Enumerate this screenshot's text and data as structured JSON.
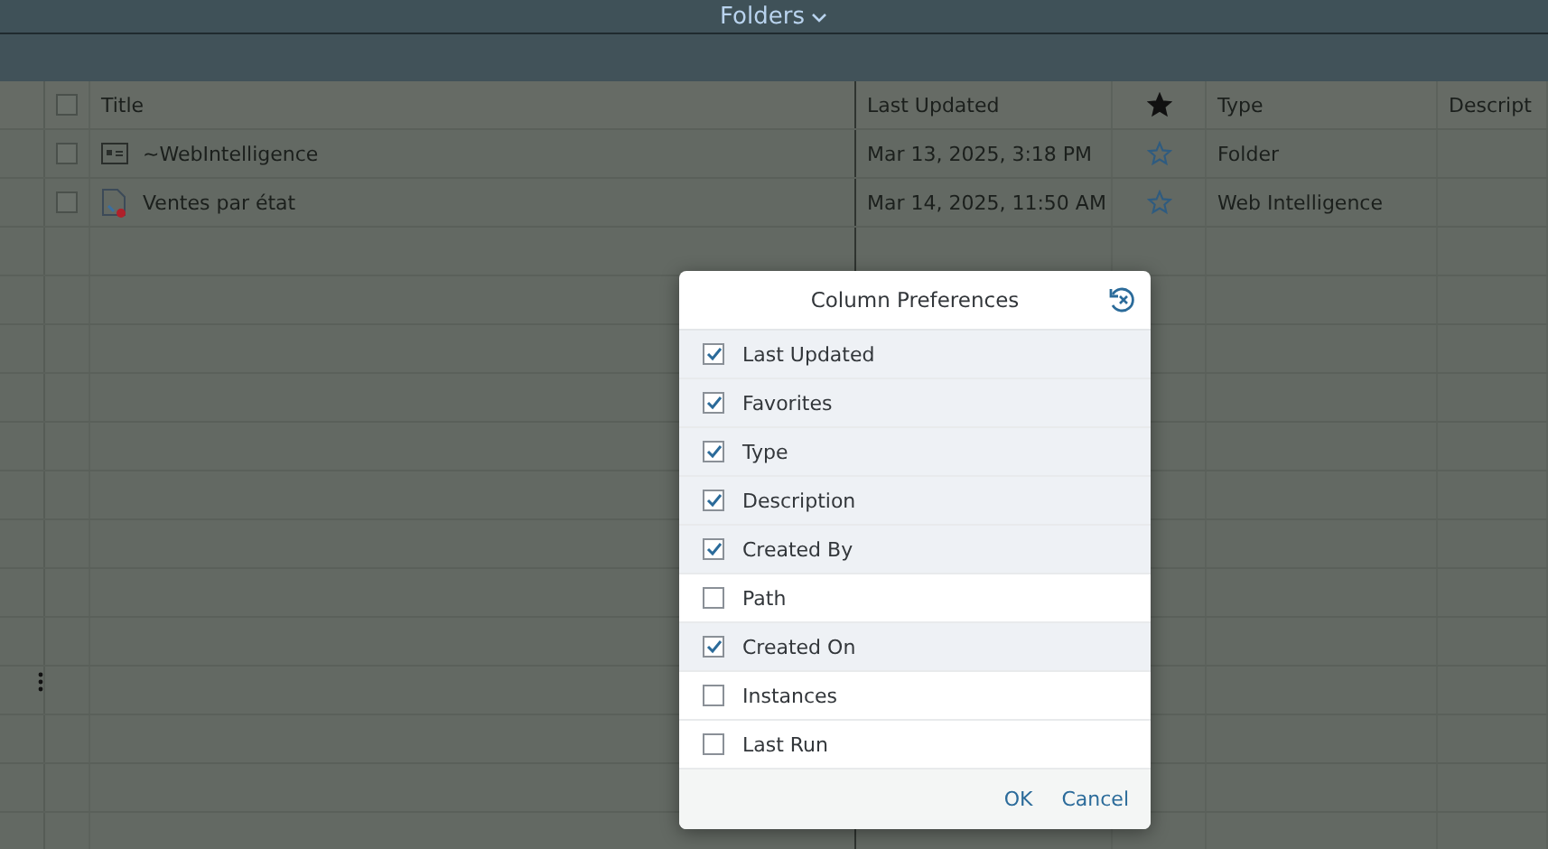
{
  "header": {
    "title": "Folders"
  },
  "table": {
    "columns": [
      {
        "kind": "title",
        "label": "Title"
      },
      {
        "kind": "date",
        "label": "Last Updated"
      },
      {
        "kind": "favorite"
      },
      {
        "kind": "type",
        "label": "Type"
      },
      {
        "kind": "description",
        "label": "Descript"
      }
    ],
    "select_all": {
      "checked": false
    },
    "rows": [
      {
        "kind": "folder",
        "title": "~WebIntelligence",
        "last_updated": "Mar 13, 2025, 3:18 PM",
        "favorite": false,
        "type": "Folder",
        "checked": false
      },
      {
        "kind": "document",
        "title": "Ventes par état",
        "last_updated": "Mar 14, 2025, 11:50 AM",
        "favorite": false,
        "type": "Web Intelligence",
        "checked": false
      }
    ]
  },
  "dialog": {
    "title": "Column Preferences",
    "items": [
      {
        "label": "Last Updated",
        "checked": true
      },
      {
        "label": "Favorites",
        "checked": true
      },
      {
        "label": "Type",
        "checked": true
      },
      {
        "label": "Description",
        "checked": true
      },
      {
        "label": "Created By",
        "checked": true
      },
      {
        "label": "Path",
        "checked": false
      },
      {
        "label": "Created On",
        "checked": true
      },
      {
        "label": "Instances",
        "checked": false
      },
      {
        "label": "Last Run",
        "checked": false
      }
    ],
    "buttons": [
      "OK",
      "Cancel"
    ]
  }
}
